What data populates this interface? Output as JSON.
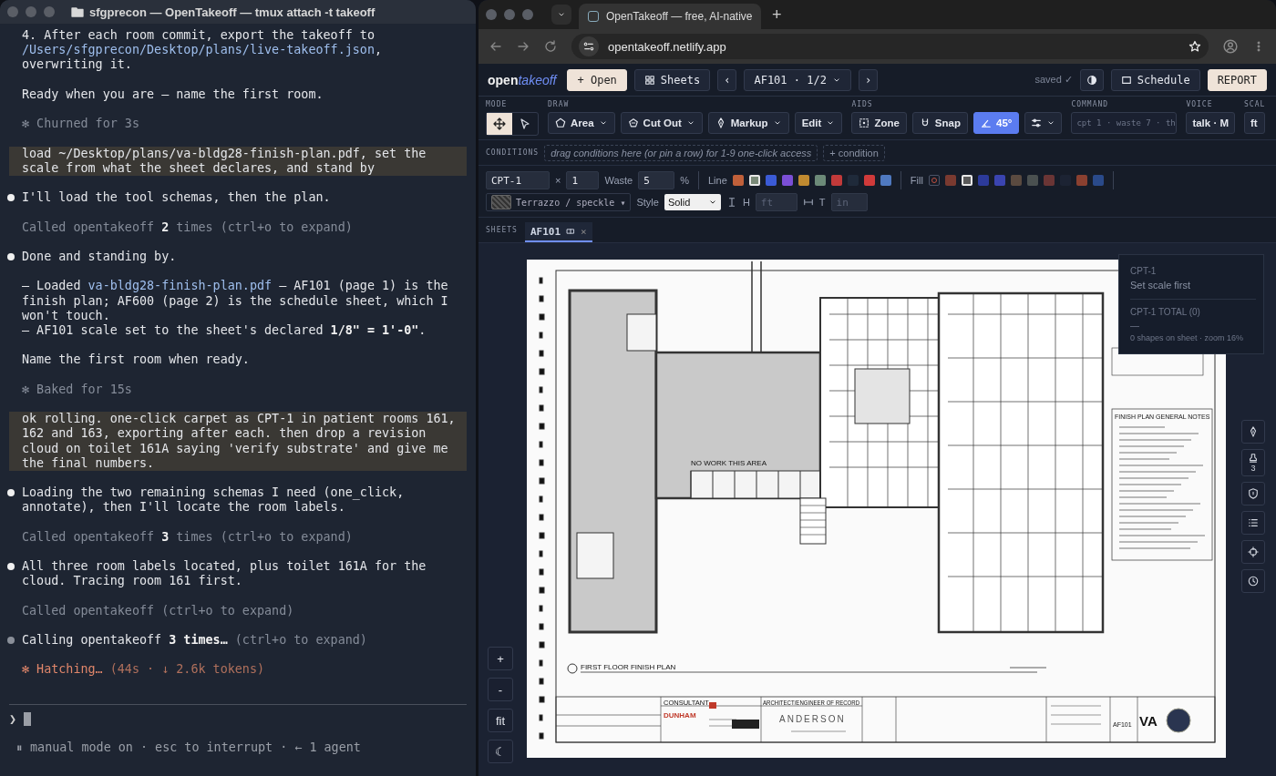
{
  "terminal": {
    "title": "sfgprecon — OpenTakeoff — tmux attach -t takeoff",
    "blocks": [
      {
        "kind": "plain",
        "parts": [
          {
            "kind": "plain",
            "text": "4. After each room commit, export the takeoff to\n"
          },
          {
            "kind": "path",
            "text": "/Users/sfgprecon/Desktop/plans/live-takeoff.json"
          },
          {
            "kind": "plain",
            "text": ",\noverwriting it."
          }
        ]
      },
      {
        "kind": "plain",
        "parts": [
          {
            "kind": "plain",
            "text": "Ready when you are — name the first room."
          }
        ]
      },
      {
        "kind": "status",
        "parts": [
          {
            "kind": "dim",
            "text": "✻ Churned for 3s"
          }
        ]
      },
      {
        "kind": "prompt",
        "parts": [
          {
            "kind": "plain",
            "text": "load ~/Desktop/plans/va-bldg28-finish-plan.pdf, set the\nscale from what the sheet declares, and stand by"
          }
        ]
      },
      {
        "kind": "bullet",
        "done": true,
        "parts": [
          {
            "kind": "plain",
            "text": "I'll load the tool schemas, then the plan."
          }
        ]
      },
      {
        "kind": "called",
        "parts": [
          {
            "kind": "dim",
            "text": "Called opentakeoff "
          },
          {
            "kind": "bold",
            "text": "2"
          },
          {
            "kind": "dim",
            "text": " times (ctrl+o to expand)"
          }
        ]
      },
      {
        "kind": "bullet",
        "done": true,
        "parts": [
          {
            "kind": "plain",
            "text": "Done and standing by."
          }
        ]
      },
      {
        "kind": "plain",
        "parts": [
          {
            "kind": "plain",
            "text": "— Loaded "
          },
          {
            "kind": "path",
            "text": "va-bldg28-finish-plan.pdf"
          },
          {
            "kind": "plain",
            "text": " — AF101 (page 1) is the\nfinish plan; AF600 (page 2) is the schedule sheet, which I\nwon't touch.\n— AF101 scale set to the sheet's declared "
          },
          {
            "kind": "bold",
            "text": "1/8\" = 1'-0\""
          },
          {
            "kind": "plain",
            "text": "."
          }
        ]
      },
      {
        "kind": "plain",
        "parts": [
          {
            "kind": "plain",
            "text": "Name the first room when ready."
          }
        ]
      },
      {
        "kind": "status",
        "parts": [
          {
            "kind": "dim",
            "text": "✻ Baked for 15s"
          }
        ]
      },
      {
        "kind": "prompt",
        "parts": [
          {
            "kind": "plain",
            "text": "ok rolling. one-click carpet as CPT-1 in patient rooms 161,\n162 and 163, exporting after each. then drop a revision\ncloud on toilet 161A saying 'verify substrate' and give me\nthe final numbers."
          }
        ]
      },
      {
        "kind": "bullet",
        "done": true,
        "parts": [
          {
            "kind": "plain",
            "text": "Loading the two remaining schemas I need (one_click,\nannotate), then I'll locate the room labels."
          }
        ]
      },
      {
        "kind": "called",
        "parts": [
          {
            "kind": "dim",
            "text": "Called opentakeoff "
          },
          {
            "kind": "bold",
            "text": "3"
          },
          {
            "kind": "dim",
            "text": " times (ctrl+o to expand)"
          }
        ]
      },
      {
        "kind": "bullet",
        "done": true,
        "parts": [
          {
            "kind": "plain",
            "text": "All three room labels located, plus toilet 161A for the\ncloud. Tracing room 161 first."
          }
        ]
      },
      {
        "kind": "called",
        "parts": [
          {
            "kind": "dim",
            "text": "Called opentakeoff (ctrl+o to expand)"
          }
        ]
      },
      {
        "kind": "bullet",
        "done": false,
        "parts": [
          {
            "kind": "plain",
            "text": "Calling opentakeoff "
          },
          {
            "kind": "bold",
            "text": "3 times…"
          },
          {
            "kind": "dim",
            "text": " (ctrl+o to expand)"
          }
        ]
      },
      {
        "kind": "spinner",
        "parts": [
          {
            "kind": "orange",
            "text": "✻ Hatching… "
          },
          {
            "kind": "dimorange",
            "text": "(44s · ↓ 2.6k tokens)"
          }
        ]
      }
    ],
    "prompt_symbol": "❯",
    "status_line": "⏸ manual mode on · esc to interrupt · ← 1 agent"
  },
  "browser": {
    "tab_title": "OpenTakeoff — free, AI-native",
    "new_tab": "+",
    "url": "opentakeoff.netlify.app"
  },
  "app": {
    "logo": {
      "first": "open",
      "second": "takeoff"
    },
    "header": {
      "open_button": "+ Open",
      "sheets_button": "Sheets",
      "prev": "‹",
      "sheet_picker": "AF101 · 1/2",
      "next": "›",
      "saved": "saved ✓",
      "schedule_button": "Schedule",
      "report_button": "REPORT"
    },
    "toolbar": {
      "mode": {
        "label": "MODE",
        "items": [
          {
            "selected": true
          },
          {
            "selected": false
          }
        ]
      },
      "draw": {
        "label": "DRAW",
        "buttons": [
          "Area",
          "Cut Out",
          "Markup",
          "Edit"
        ]
      },
      "aids": {
        "label": "AIDS",
        "items": [
          {
            "label": "Zone",
            "on": false
          },
          {
            "label": "Snap",
            "on": false
          },
          {
            "label": "45°",
            "on": true
          }
        ]
      },
      "command": {
        "label": "COMMAND",
        "placeholder": "cpt 1 · waste 7 · th"
      },
      "voice": {
        "label": "VOICE",
        "button": "talk · M"
      },
      "scale": {
        "label": "SCAL",
        "button": "ft"
      }
    },
    "conditions": {
      "label": "CONDITIONS",
      "dropzone": "drag conditions here (or pin a row) for 1-9 one-click access",
      "add_button": "+ condition"
    },
    "properties": {
      "name": "CPT-1",
      "times": "×",
      "quantity": "1",
      "waste_label": "Waste",
      "waste": "5",
      "percent": "%",
      "line_label": "Line",
      "line_colors": [
        {
          "color": "#c0603a",
          "selected": false
        },
        {
          "color": "#7a8a78",
          "selected": true
        },
        {
          "color": "#3b5bd6",
          "selected": false
        },
        {
          "color": "#7b4fd6",
          "selected": false
        },
        {
          "color": "#c08a30",
          "selected": false
        },
        {
          "color": "#6c8a78",
          "selected": false
        },
        {
          "color": "#c23a3a",
          "selected": false
        },
        {
          "color": "#1f2a3a",
          "selected": false
        },
        {
          "color": "#d03a3a",
          "selected": false
        },
        {
          "color": "#4f79c0",
          "selected": false
        }
      ],
      "fill_label": "Fill",
      "fill_colors": [
        {
          "kind": "none",
          "selected": false
        },
        {
          "kind": "color",
          "color": "#7a3a30",
          "selected": false
        },
        {
          "kind": "color",
          "color": "#5a5a5a",
          "selected": true
        },
        {
          "kind": "color",
          "color": "#2c3a9a",
          "selected": false
        },
        {
          "kind": "color",
          "color": "#3a44b0",
          "selected": false
        },
        {
          "kind": "color",
          "color": "#5a4a40",
          "selected": false
        },
        {
          "kind": "color",
          "color": "#4a5050",
          "selected": false
        },
        {
          "kind": "color",
          "color": "#6a3535",
          "selected": false
        },
        {
          "kind": "color",
          "color": "#1c2333",
          "selected": false
        },
        {
          "kind": "color",
          "color": "#8a4030",
          "selected": false
        },
        {
          "kind": "color",
          "color": "#2a4a8a",
          "selected": false
        }
      ],
      "pattern": "Terrazzo / speckle",
      "pattern_caret": "▾",
      "style_label": "Style",
      "style_value": "Solid",
      "height_label": "H",
      "height_placeholder": "ft",
      "thickness_label": "T",
      "thickness_placeholder": "in"
    },
    "sheets": {
      "label": "SHEETS",
      "tabs": [
        {
          "label": "AF101",
          "selected": true
        }
      ],
      "close": "×"
    },
    "canvas": {
      "zoom_controls": [
        "+",
        "-",
        "fit",
        "☾"
      ],
      "stamp_count": "3",
      "popover": {
        "condition": "CPT-1",
        "message": "Set scale first",
        "total": "CPT-1 TOTAL (0)",
        "value": "—",
        "footer": "0 shapes on sheet · zoom 16%"
      },
      "sheet": {
        "plan_title": "FIRST FLOOR FINISH PLAN",
        "area_note": "NO WORK THIS AREA",
        "notes_title": "FINISH PLAN GENERAL NOTES",
        "consultant": "CONSULTANT",
        "consultant_firm": "DUNHAM",
        "architect": "ARCHITECT/ENGINEER OF RECORD",
        "architect_firm": "ANDERSON",
        "client": "VA",
        "sheet_number": "AF101"
      }
    }
  }
}
